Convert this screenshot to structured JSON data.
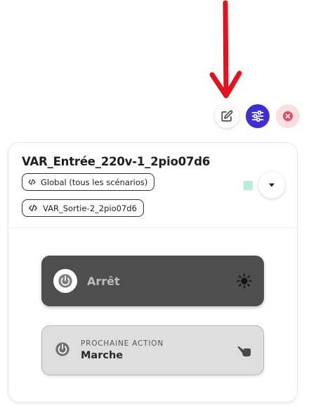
{
  "toolbar": {
    "edit_icon": "pencil-square-icon",
    "settings_icon": "sliders-icon",
    "close_icon": "close-circle-icon",
    "settings_color": "#3f2fd0",
    "close_color": "#e8475f"
  },
  "annotation": {
    "color": "#e0141e"
  },
  "card": {
    "title": "VAR_Entrée_220v-1_2pio07d6",
    "tags": [
      {
        "icon": "code-icon",
        "label": "Global (tous les scénarios)"
      },
      {
        "icon": "code-icon",
        "label": "VAR_Sortie-2_2pio07d6"
      }
    ],
    "swatch_color": "#b8ecd6",
    "expand_icon": "caret-down-icon"
  },
  "current_state": {
    "label": "Arrêt",
    "icon": "power-icon",
    "state_icon": "sun-icon",
    "background": "#4e4e4e"
  },
  "next_action": {
    "caption": "PROCHAINE ACTION",
    "value": "Marche",
    "icon": "power-icon",
    "action_icon": "hand-pointer-icon"
  }
}
